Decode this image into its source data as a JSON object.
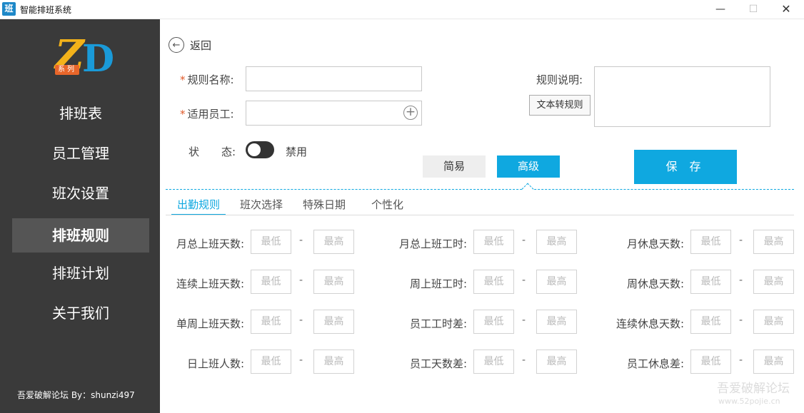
{
  "window": {
    "icon_char": "班",
    "title": "智能排班系统",
    "min_glyph": "—",
    "max_glyph": "☐",
    "close_glyph": "✕"
  },
  "sidebar": {
    "logo": {
      "z": "Z",
      "d": "D",
      "tag": "系列"
    },
    "items": [
      {
        "label": "排班表",
        "active": false
      },
      {
        "label": "员工管理",
        "active": false
      },
      {
        "label": "班次设置",
        "active": false
      },
      {
        "label": "排班规则",
        "active": true
      },
      {
        "label": "排班计划",
        "active": false
      },
      {
        "label": "关于我们",
        "active": false
      }
    ],
    "credit": "吾爱破解论坛 By：shunzi497"
  },
  "form": {
    "back_label": "返回",
    "back_glyph": "←",
    "required_mark": "*",
    "rule_name_label": "规则名称:",
    "rule_name_value": "",
    "employees_label": "适用员工:",
    "employees_value": "",
    "description_label": "规则说明:",
    "description_value": "",
    "text_to_rule_label": "文本转规则",
    "status_label_1": "状",
    "status_label_2": "态:",
    "status_value": "禁用",
    "status_on": false,
    "mode_simple": "简易",
    "mode_advanced": "高级",
    "save_label": "保 存",
    "plus_glyph": "+"
  },
  "tabs": [
    {
      "label": "出勤规则",
      "active": true
    },
    {
      "label": "班次选择",
      "active": false
    },
    {
      "label": "特殊日期",
      "active": false
    },
    {
      "label": "个性化",
      "active": false
    }
  ],
  "range_fields": {
    "min_placeholder": "最低",
    "max_placeholder": "最高",
    "separator": "-",
    "columns": [
      [
        "月总上班天数:",
        "连续上班天数:",
        "单周上班天数:",
        "日上班人数:"
      ],
      [
        "月总上班工时:",
        "周上班工时:",
        "员工工时差:",
        "员工天数差:"
      ],
      [
        "月休息天数:",
        "周休息天数:",
        "连续休息天数:",
        "员工休息差:"
      ]
    ]
  },
  "watermark": {
    "text": "吾爱破解论坛",
    "url": "www.52pojie.cn"
  }
}
